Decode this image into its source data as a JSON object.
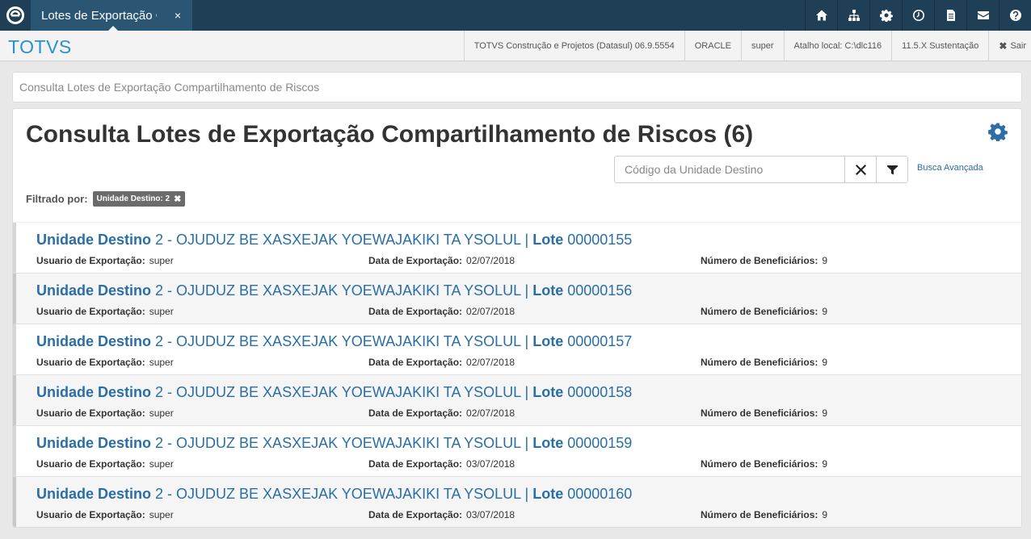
{
  "tab": {
    "title": "Lotes de Exportação Compartilhamento de Riscos",
    "close": "×"
  },
  "header": {
    "brand": "TOTVS",
    "product": "TOTVS Construção e Projetos (Datasul) 06.9.5554",
    "database": "ORACLE",
    "user": "super",
    "shortcut": "Atalho local: C:\\dlc116",
    "version": "11.5.X Sustentação",
    "logout": "Sair"
  },
  "breadcrumb": "Consulta Lotes de Exportação Compartilhamento de Riscos",
  "page": {
    "title": "Consulta Lotes de Exportação Compartilhamento de Riscos (6)",
    "search_placeholder": "Código da Unidade Destino",
    "advanced_search": "Busca Avançada",
    "filter_label": "Filtrado por:",
    "filter_tag": "Unidade Destino: 2"
  },
  "labels": {
    "unit": "Unidade Destino",
    "lot": "Lote",
    "user": "Usuario de Exportação:",
    "date": "Data de Exportação:",
    "beneficiaries": "Número de Beneficiários:"
  },
  "rows": [
    {
      "unit_code": "2",
      "unit_name": "OJUDUZ BE XASXEJAK YOEWAJAKIKI TA YSOLUL",
      "lot": "00000155",
      "user": "super",
      "date": "02/07/2018",
      "beneficiaries": "9"
    },
    {
      "unit_code": "2",
      "unit_name": "OJUDUZ BE XASXEJAK YOEWAJAKIKI TA YSOLUL",
      "lot": "00000156",
      "user": "super",
      "date": "02/07/2018",
      "beneficiaries": "9"
    },
    {
      "unit_code": "2",
      "unit_name": "OJUDUZ BE XASXEJAK YOEWAJAKIKI TA YSOLUL",
      "lot": "00000157",
      "user": "super",
      "date": "02/07/2018",
      "beneficiaries": "9"
    },
    {
      "unit_code": "2",
      "unit_name": "OJUDUZ BE XASXEJAK YOEWAJAKIKI TA YSOLUL",
      "lot": "00000158",
      "user": "super",
      "date": "02/07/2018",
      "beneficiaries": "9"
    },
    {
      "unit_code": "2",
      "unit_name": "OJUDUZ BE XASXEJAK YOEWAJAKIKI TA YSOLUL",
      "lot": "00000159",
      "user": "super",
      "date": "03/07/2018",
      "beneficiaries": "9"
    },
    {
      "unit_code": "2",
      "unit_name": "OJUDUZ BE XASXEJAK YOEWAJAKIKI TA YSOLUL",
      "lot": "00000160",
      "user": "super",
      "date": "03/07/2018",
      "beneficiaries": "9"
    }
  ],
  "icons": [
    "totvs-logo-icon",
    "home-icon",
    "sitemap-icon",
    "gear-icon",
    "clock-icon",
    "document-icon",
    "mail-icon",
    "help-icon",
    "clear-icon",
    "filter-icon",
    "settings-gear-icon"
  ],
  "colors": {
    "topbar": "#1e3f55",
    "tab": "#2a5674",
    "brand": "#2a91d0",
    "link": "#2a6ea6"
  }
}
